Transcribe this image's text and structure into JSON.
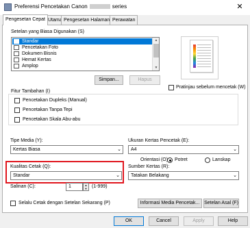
{
  "window": {
    "title_left": "Preferensi Pencetakan Canon",
    "title_right": "series",
    "close_glyph": "✕"
  },
  "tabs": [
    {
      "label": "Pengesetan Cepat",
      "active": true
    },
    {
      "label": "Utama",
      "active": false
    },
    {
      "label": "Pengesetan Halaman",
      "active": false
    },
    {
      "label": "Perawatan",
      "active": false
    }
  ],
  "common_settings": {
    "label": "Setelan yang Biasa Digunakan (S)",
    "items": [
      "Standar",
      "Pencetakan Foto",
      "Dokumen Bisnis",
      "Hemat Kertas",
      "Amplop"
    ],
    "selected": "Standar",
    "save_button": "Simpan...",
    "delete_button": "Hapus"
  },
  "preview": {
    "checkbox_label": "Pratinjau sebelum mencetak (W)"
  },
  "additional": {
    "label": "Fitur Tambahan (I)",
    "options": [
      "Pencetakan Dupleks (Manual)",
      "Pencetakan Tanpa Tepi",
      "Pencetakan Skala Abu-abu"
    ]
  },
  "media_type": {
    "label": "Tipe Media (Y):",
    "value": "Kertas Biasa"
  },
  "paper_size": {
    "label": "Ukuran Kertas Pencetak (E):",
    "value": "A4"
  },
  "orientation": {
    "label": "Orientasi (O):",
    "portrait": "Potret",
    "landscape": "Lanskap",
    "selected": "Potret"
  },
  "print_quality": {
    "label": "Kualitas Cetak (Q):",
    "value": "Standar"
  },
  "paper_source": {
    "label": "Sumber Kertas (R):",
    "value": "Tatakan Belakang"
  },
  "copies": {
    "label": "Salinan (C):",
    "value": "1",
    "range": "(1-999)"
  },
  "always_print": {
    "label": "Selalu Cetak dengan Setelan Sekarang (P)"
  },
  "buttons": {
    "media_info": "Informasi Media Pencetak...",
    "defaults": "Setelan Asal (F)",
    "ok": "OK",
    "cancel": "Cancel",
    "apply": "Apply",
    "help": "Help"
  },
  "colors": {
    "accent": "#0078d7",
    "highlight_border": "#e0141c"
  }
}
